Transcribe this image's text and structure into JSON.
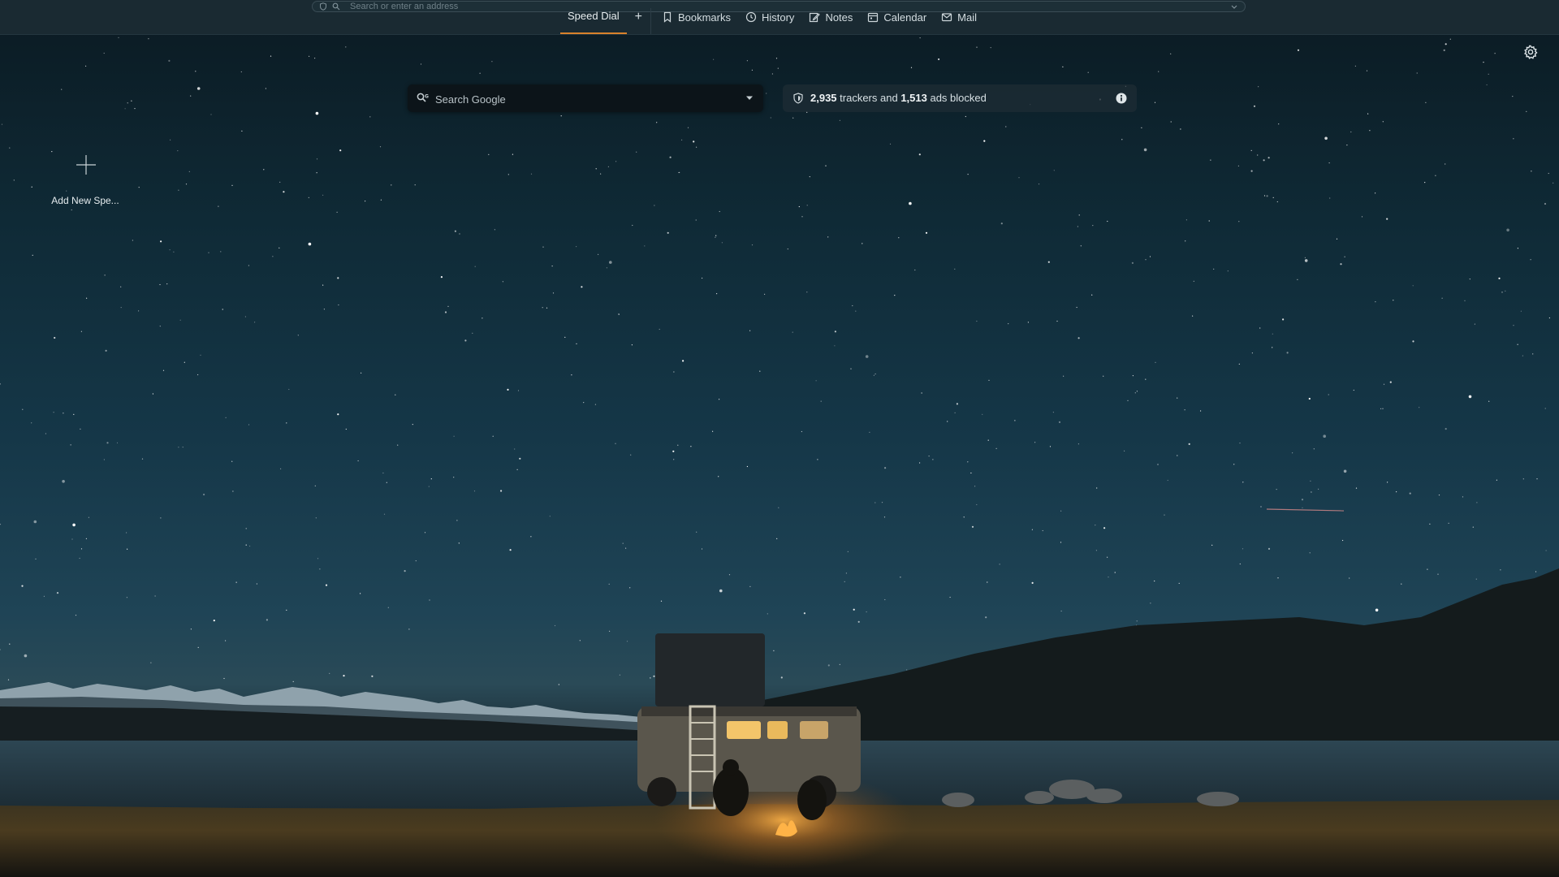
{
  "address_bar": {
    "placeholder": "Search or enter an address"
  },
  "tabs": [
    {
      "label": "Speed Dial",
      "icon": "none",
      "active": true
    },
    {
      "label": "Bookmarks",
      "icon": "bookmark-icon"
    },
    {
      "label": "History",
      "icon": "clock-icon"
    },
    {
      "label": "Notes",
      "icon": "pencil-icon"
    },
    {
      "label": "Calendar",
      "icon": "calendar-icon"
    },
    {
      "label": "Mail",
      "icon": "mail-icon"
    }
  ],
  "tab_add_label": "+",
  "search": {
    "placeholder": "Search Google"
  },
  "tracker": {
    "trackers_count": "2,935",
    "trackers_text": " trackers and ",
    "ads_count": "1,513",
    "ads_text": " ads blocked"
  },
  "speed_dial": {
    "add_label": "Add New Spe..."
  },
  "colors": {
    "accent": "#d9822b",
    "topbar_bg": "#1a2a32",
    "search_bg": "#0c1419"
  }
}
